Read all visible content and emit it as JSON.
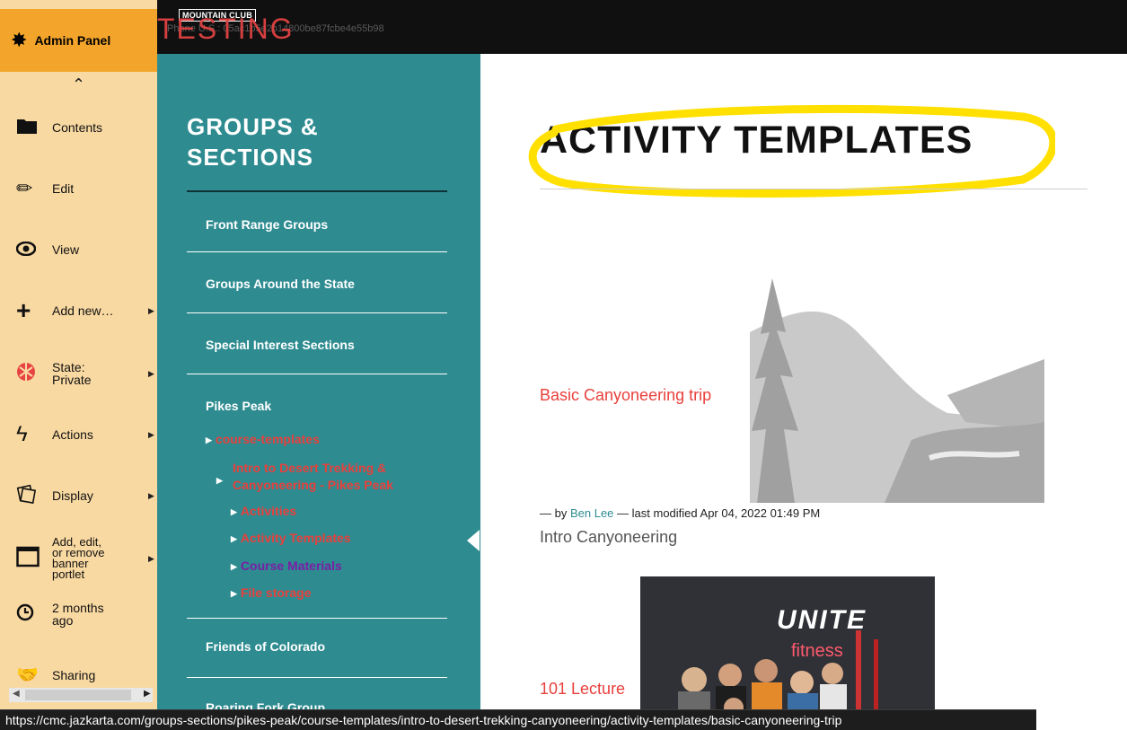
{
  "header": {
    "logo_text": "MOUNTAIN CLUB",
    "phone_text": "Phone U.S.: 05ac1b5e2b14800be87fcbe4e55b98",
    "testing_label": "TESTING"
  },
  "admin_panel": {
    "title": "Admin Panel",
    "items": [
      {
        "label": "Contents",
        "icon": "folder-icon",
        "has_submenu": false
      },
      {
        "label": "Edit",
        "icon": "pencil-icon",
        "has_submenu": false
      },
      {
        "label": "View",
        "icon": "eye-icon",
        "has_submenu": false
      },
      {
        "label": "Add new…",
        "icon": "plus-icon",
        "has_submenu": true
      },
      {
        "label": "State: Private",
        "icon": "state-icon",
        "has_submenu": true
      },
      {
        "label": "Actions",
        "icon": "bolt-icon",
        "has_submenu": true
      },
      {
        "label": "Display",
        "icon": "display-icon",
        "has_submenu": true
      },
      {
        "label": "Add, edit, or remove banner portlet",
        "icon": "window-icon",
        "has_submenu": true
      },
      {
        "label": "2 months ago",
        "icon": "clock-icon",
        "has_submenu": false
      },
      {
        "label": "Sharing",
        "icon": "handshake-icon",
        "has_submenu": false
      }
    ]
  },
  "groups_nav": {
    "title_line1": "GROUPS &",
    "title_line2": "SECTIONS",
    "links": [
      "Front Range Groups",
      "Groups Around the State",
      "Special Interest Sections",
      "Pikes Peak",
      "Friends of Colorado",
      "Roaring Fork Group"
    ],
    "subitems": [
      "course-templates",
      "Intro to Desert Trekking & Canyoneering - Pikes Peak",
      "Activities",
      "Activity Templates",
      "Course Materials",
      "File storage"
    ]
  },
  "main": {
    "page_title": "ACTIVITY TEMPLATES",
    "items": [
      {
        "title": "Basic Canyoneering trip",
        "byline_prefix": "— by",
        "author": "Ben Lee",
        "byline_suffix": "— last modified Apr 04, 2022 01:49 PM",
        "description": "Intro Canyoneering"
      },
      {
        "title": "101 Lecture",
        "image_text": "UNITE",
        "image_subtext": "fitness"
      }
    ]
  },
  "status_url": "https://cmc.jazkarta.com/groups-sections/pikes-peak/course-templates/intro-to-desert-trekking-canyoneering/activity-templates/basic-canyoneering-trip",
  "colors": {
    "accent_teal": "#2e8c91",
    "link_red": "#e8403c",
    "admin_orange": "#f3a52b",
    "highlight_yellow": "#ffe000"
  }
}
